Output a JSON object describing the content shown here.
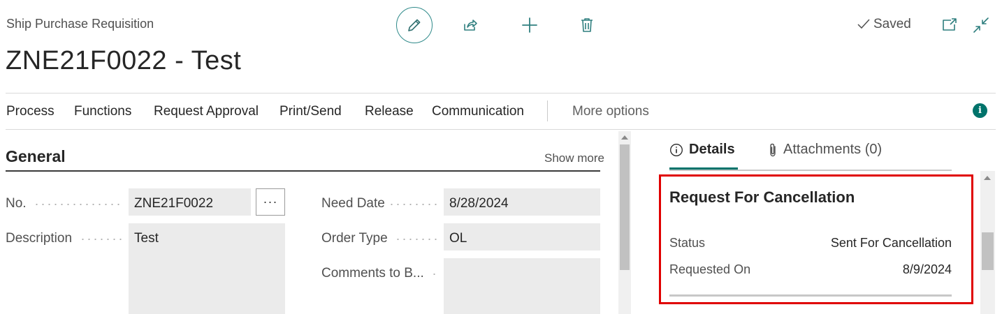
{
  "header": {
    "caption": "Ship Purchase Requisition",
    "title": "ZNE21F0022 - Test",
    "saved_status": "Saved",
    "toolbar_icons": [
      "edit-pencil-icon",
      "share-icon",
      "plus-icon",
      "trash-icon",
      "open-new-window-icon",
      "collapse-icon"
    ]
  },
  "actions": {
    "items": [
      "Process",
      "Functions",
      "Request Approval",
      "Print/Send",
      "Release",
      "Communication"
    ],
    "more": "More options",
    "info_badge": "i"
  },
  "general": {
    "title": "General",
    "show_more": "Show more",
    "fields": {
      "no_label": "No.",
      "no_value": "ZNE21F0022",
      "no_assist": "···",
      "description_label": "Description",
      "description_value": "Test",
      "need_date_label": "Need Date",
      "need_date_value": "8/28/2024",
      "order_type_label": "Order Type",
      "order_type_value": "OL",
      "comments_label": "Comments to B...",
      "comments_value": ""
    }
  },
  "factbox": {
    "tabs": {
      "details": "Details",
      "attachments": "Attachments (0)"
    },
    "card": {
      "title": "Request For Cancellation",
      "status_label": "Status",
      "status_value": "Sent For Cancellation",
      "requested_on_label": "Requested On",
      "requested_on_value": "8/9/2024"
    }
  },
  "colors": {
    "accent": "#00736b",
    "edit_ring": "#2f8a8a",
    "highlight": "#e00000",
    "field_bg": "#ebebeb"
  }
}
